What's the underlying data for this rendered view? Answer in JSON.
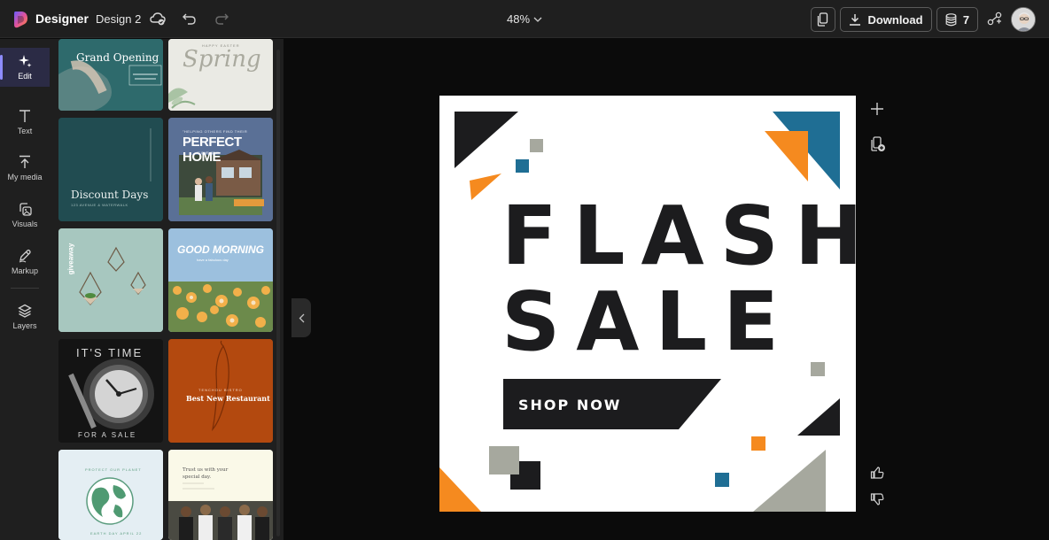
{
  "app": {
    "name": "Designer",
    "document_name": "Design 2"
  },
  "toolbar": {
    "zoom_label": "48%",
    "download_label": "Download",
    "credits_count": "7"
  },
  "rail": {
    "items": [
      {
        "label": "Edit",
        "icon": "sparkle-icon"
      },
      {
        "label": "Text",
        "icon": "text-icon"
      },
      {
        "label": "My media",
        "icon": "upload-icon"
      },
      {
        "label": "Visuals",
        "icon": "visuals-icon"
      },
      {
        "label": "Markup",
        "icon": "pen-icon"
      },
      {
        "label": "Layers",
        "icon": "layers-icon"
      }
    ]
  },
  "templates": [
    {
      "title": "Grand Opening"
    },
    {
      "title": "Spring",
      "subtitle": "HAPPY EASTER"
    },
    {
      "title": "Discount Days",
      "subtitle": "123 AVENUE & WATERWALK"
    },
    {
      "title": "PERFECT HOME",
      "subtitle": "\"HELPING OTHERS FIND THEIR",
      "subtitle2": "IS OUR JOY.\""
    },
    {
      "title": "giveaway"
    },
    {
      "title": "GOOD MORNING",
      "subtitle": "have a fabulous day"
    },
    {
      "title": "IT'S TIME",
      "subtitle": "FOR A SALE"
    },
    {
      "title": "Best New Restaurant",
      "subtitle": "TENCHOU BISTRO"
    },
    {
      "title": "PROTECT OUR PLANET",
      "subtitle": "EARTH DAY APRIL 22"
    },
    {
      "title": "Trust us with your special day."
    }
  ],
  "design": {
    "headline_1": "FLASH",
    "headline_2": "SALE",
    "cta": "SHOP NOW",
    "colors": {
      "black": "#1c1c1e",
      "orange": "#f58a1f",
      "blue": "#1f6e94",
      "gray": "#a6a89e"
    }
  }
}
